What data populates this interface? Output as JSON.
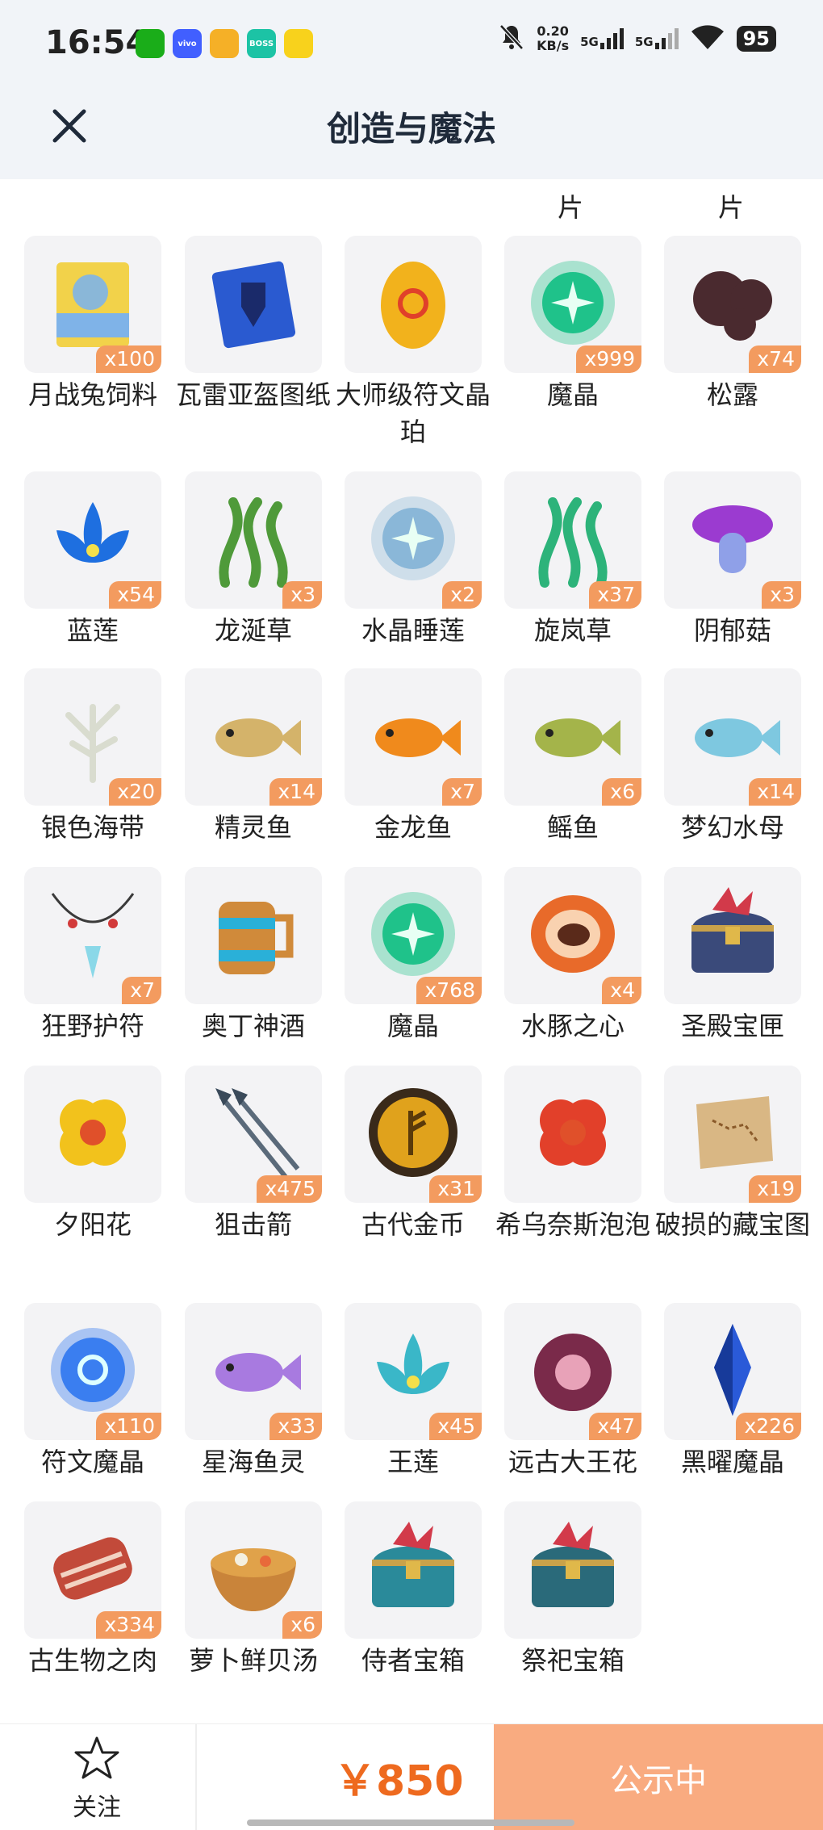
{
  "status_bar": {
    "time": "16:54",
    "net_speed_value": "0.20",
    "net_speed_unit": "KB/s",
    "signal1": "5G",
    "signal2": "5G",
    "battery": "95",
    "apps": [
      {
        "name": "wechat-icon",
        "color": "#1aad19",
        "label": ""
      },
      {
        "name": "vivo-icon",
        "color": "#415fff",
        "label": "vivo"
      },
      {
        "name": "game-icon",
        "color": "#f5b027",
        "label": ""
      },
      {
        "name": "boss-icon",
        "color": "#1cc3a5",
        "label": "BOSS"
      },
      {
        "name": "app-icon",
        "color": "#f8d21c",
        "label": ""
      }
    ]
  },
  "header": {
    "title": "创造与魔法"
  },
  "cut_row": [
    "片",
    "片"
  ],
  "items": [
    {
      "name": "月战兔饲料",
      "qty": "x100",
      "icon": "feed-bag-icon",
      "color": "#7fb3e8"
    },
    {
      "name": "瓦雷亚盔图纸",
      "qty": "",
      "icon": "blueprint-icon",
      "color": "#2a5ad0"
    },
    {
      "name": "大师级符文晶珀",
      "qty": "",
      "icon": "amber-egg-icon",
      "color": "#f2b21c"
    },
    {
      "name": "魔晶",
      "qty": "x999",
      "icon": "magic-crystal-icon",
      "color": "#1fc28a"
    },
    {
      "name": "松露",
      "qty": "x74",
      "icon": "truffle-icon",
      "color": "#4a2a2f"
    },
    {
      "name": "蓝莲",
      "qty": "x54",
      "icon": "blue-lotus-icon",
      "color": "#1e6fe0"
    },
    {
      "name": "龙涎草",
      "qty": "x3",
      "icon": "dragon-grass-icon",
      "color": "#4f9a3a"
    },
    {
      "name": "水晶睡莲",
      "qty": "x2",
      "icon": "crystal-lily-icon",
      "color": "#8ab7d8"
    },
    {
      "name": "旋岚草",
      "qty": "x37",
      "icon": "whirl-grass-icon",
      "color": "#2db37a"
    },
    {
      "name": "阴郁菇",
      "qty": "x3",
      "icon": "gloom-mushroom-icon",
      "color": "#9b3bd0"
    },
    {
      "name": "银色海带",
      "qty": "x20",
      "icon": "silver-kelp-icon",
      "color": "#d9dccf"
    },
    {
      "name": "精灵鱼",
      "qty": "x14",
      "icon": "sprite-fish-icon",
      "color": "#d4b36a"
    },
    {
      "name": "金龙鱼",
      "qty": "x7",
      "icon": "golden-arowana-icon",
      "color": "#f08a1c"
    },
    {
      "name": "鳐鱼",
      "qty": "x6",
      "icon": "ray-fish-icon",
      "color": "#a4b44a"
    },
    {
      "name": "梦幻水母",
      "qty": "x14",
      "icon": "jellyfish-icon",
      "color": "#7ec8e0"
    },
    {
      "name": "狂野护符",
      "qty": "x7",
      "icon": "amulet-icon",
      "color": "#d23a3a"
    },
    {
      "name": "奥丁神酒",
      "qty": "",
      "icon": "mead-mug-icon",
      "color": "#d08a3a"
    },
    {
      "name": "魔晶",
      "qty": "x768",
      "icon": "magic-crystal-icon",
      "color": "#1fc28a"
    },
    {
      "name": "水豚之心",
      "qty": "x4",
      "icon": "capybara-heart-icon",
      "color": "#e86a2a"
    },
    {
      "name": "圣殿宝匣",
      "qty": "",
      "icon": "temple-box-icon",
      "color": "#3a4a7a"
    },
    {
      "name": "夕阳花",
      "qty": "",
      "icon": "sunset-flower-icon",
      "color": "#f2c21c"
    },
    {
      "name": "狙击箭",
      "qty": "x475",
      "icon": "arrow-icon",
      "color": "#5a6a7a"
    },
    {
      "name": "古代金币",
      "qty": "x31",
      "icon": "gold-coin-icon",
      "color": "#e0a21c"
    },
    {
      "name": "希乌奈斯泡泡",
      "qty": "",
      "icon": "bubble-flower-icon",
      "color": "#e2402a"
    },
    {
      "name": "破损的藏宝图",
      "qty": "x19",
      "icon": "treasure-map-icon",
      "color": "#d9b784"
    },
    {
      "name": "符文魔晶",
      "qty": "x110",
      "icon": "rune-crystal-icon",
      "color": "#3a7ef0"
    },
    {
      "name": "星海鱼灵",
      "qty": "x33",
      "icon": "star-fish-spirit-icon",
      "color": "#a87ae0"
    },
    {
      "name": "王莲",
      "qty": "x45",
      "icon": "king-lotus-icon",
      "color": "#3ab7c8"
    },
    {
      "name": "远古大王花",
      "qty": "x47",
      "icon": "rafflesia-icon",
      "color": "#7a2a4a"
    },
    {
      "name": "黑曜魔晶",
      "qty": "x226",
      "icon": "obsidian-crystal-icon",
      "color": "#2a5ad8"
    },
    {
      "name": "古生物之肉",
      "qty": "x334",
      "icon": "meat-icon",
      "color": "#c24a3a"
    },
    {
      "name": "萝卜鲜贝汤",
      "qty": "x6",
      "icon": "soup-bowl-icon",
      "color": "#e0a24a"
    },
    {
      "name": "侍者宝箱",
      "qty": "",
      "icon": "treasure-chest-icon",
      "color": "#2a8a9a"
    },
    {
      "name": "祭祀宝箱",
      "qty": "",
      "icon": "treasure-chest-icon",
      "color": "#2a6a7a"
    }
  ],
  "bottom": {
    "follow_label": "关注",
    "price": "￥850",
    "action_label": "公示中"
  },
  "colors": {
    "accent": "#ee6a1f",
    "badge": "#f39b5f",
    "action_bg": "#f9ab80"
  }
}
